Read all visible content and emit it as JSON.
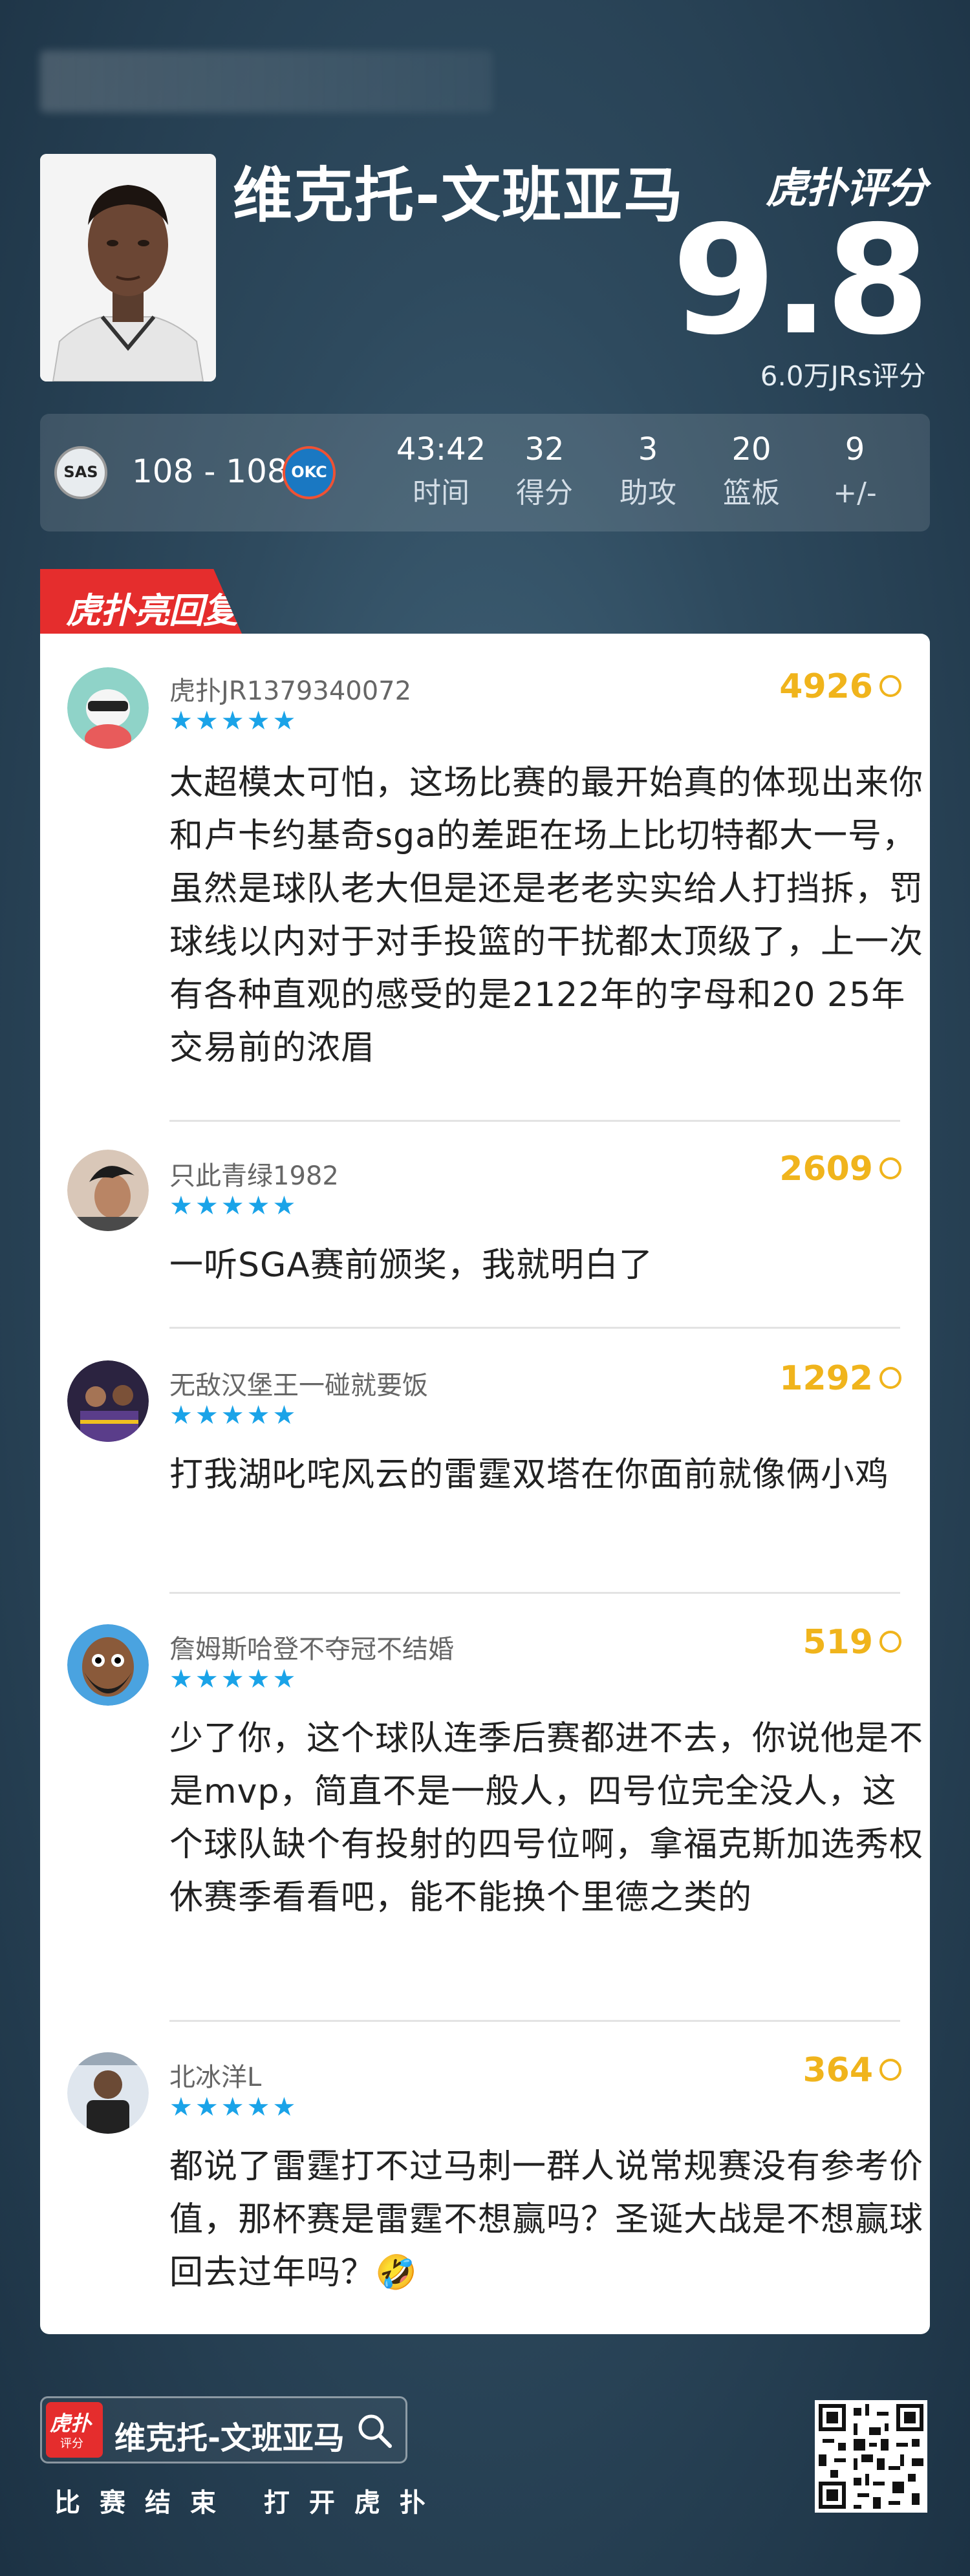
{
  "header": {
    "player_name": "维克托-文班亚马",
    "brand": "虎扑评分",
    "score": "9.8",
    "jrs_count": "6.0万JRs评分"
  },
  "game": {
    "score_text": "108 - 108",
    "home_team_logo": "SAS",
    "away_team_logo": "OKC",
    "stats": [
      {
        "value": "43:42",
        "label": "时间"
      },
      {
        "value": "32",
        "label": "得分"
      },
      {
        "value": "3",
        "label": "助攻"
      },
      {
        "value": "20",
        "label": "篮板"
      },
      {
        "value": "9",
        "label": "+/-"
      }
    ]
  },
  "section_label": "虎扑亮回复",
  "comments": [
    {
      "user": "虎扑JR1379340072",
      "stars": "★★★★★",
      "likes": "4926",
      "text": "太超模太可怕，这场比赛的最开始真的体现出来你和卢卡约基奇sga的差距在场上比切特都大一号，虽然是球队老大但是还是老老实实给人打挡拆，罚球线以内对于对手投篮的干扰都太顶级了，上一次有各种直观的感受的是2122年的字母和20 25年交易前的浓眉"
    },
    {
      "user": "只此青绿1982",
      "stars": "★★★★★",
      "likes": "2609",
      "text": "一听SGA赛前颁奖，我就明白了"
    },
    {
      "user": "无敌汉堡王一碰就要饭",
      "stars": "★★★★★",
      "likes": "1292",
      "text": "打我湖叱咤风云的雷霆双塔在你面前就像俩小鸡"
    },
    {
      "user": "詹姆斯哈登不夺冠不结婚",
      "stars": "★★★★★",
      "likes": "519",
      "text": "少了你，这个球队连季后赛都进不去，你说他是不是mvp，简直不是一般人，四号位完全没人，这个球队缺个有投射的四号位啊，拿福克斯加选秀权休赛季看看吧，能不能换个里德之类的"
    },
    {
      "user": "北冰洋L",
      "stars": "★★★★★",
      "likes": "364",
      "text": "都说了雷霆打不过马刺一群人说常规赛没有参考价值，那杯赛是雷霆不想赢吗？圣诞大战是不想赢球回去过年吗？🤣"
    }
  ],
  "footer": {
    "logo_text": "虎扑",
    "logo_sub": "评分",
    "search_text": "维克托-文班亚马",
    "cta": "比赛结束 打开虎扑"
  }
}
